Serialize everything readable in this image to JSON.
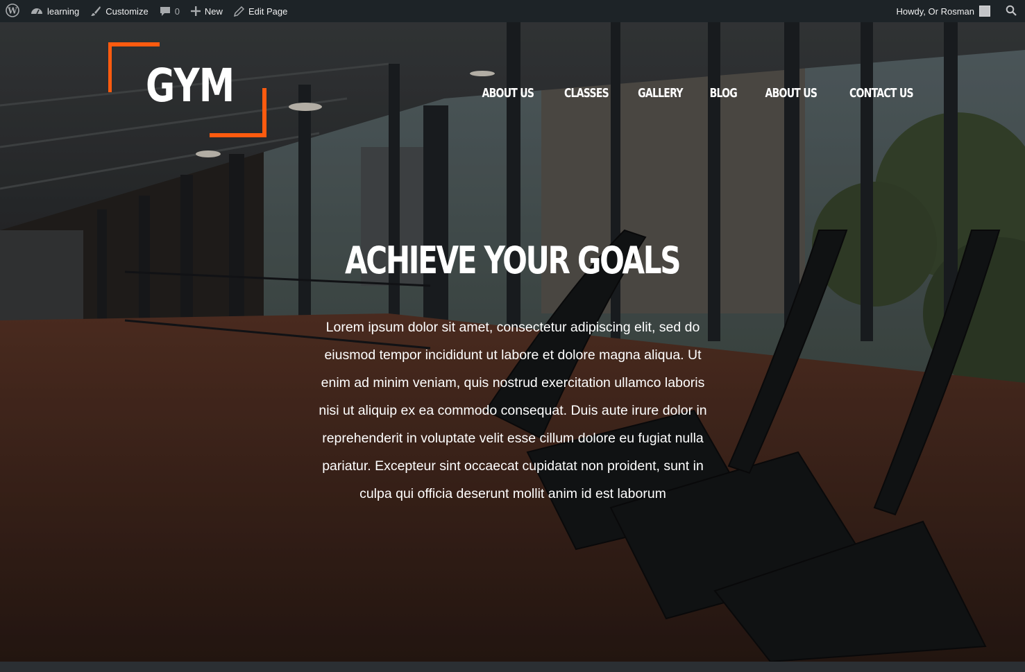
{
  "admin_bar": {
    "site_name": "learning",
    "customize": "Customize",
    "comments_count": "0",
    "new": "New",
    "edit_page": "Edit Page",
    "howdy": "Howdy, Or Rosman"
  },
  "brand": {
    "logo_text": "GYM",
    "accent_color": "#ff5b0f"
  },
  "nav": {
    "items": [
      "ABOUT US",
      "CLASSES",
      "GALLERY",
      "BLOG",
      "ABOUT US",
      "CONTACT US"
    ]
  },
  "hero": {
    "headline": "ACHIEVE YOUR GOALS",
    "body": "Lorem ipsum dolor sit amet, consectetur adipiscing elit, sed do eiusmod tempor incididunt ut labore et dolore magna aliqua. Ut enim ad minim veniam, quis nostrud exercitation ullamco laboris nisi ut aliquip ex ea commodo consequat. Duis aute irure dolor in reprehenderit in voluptate velit esse cillum dolore eu fugiat nulla pariatur. Excepteur sint occaecat cupidatat non proident, sunt in culpa qui officia deserunt mollit anim id est laborum"
  }
}
